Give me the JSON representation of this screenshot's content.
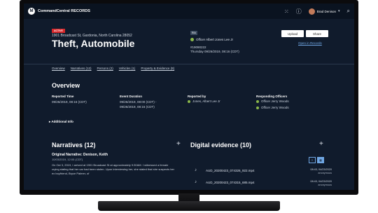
{
  "app": {
    "title": "CommandCentral RECORDS",
    "logo_glyph": "M"
  },
  "user": {
    "name": "Brad Denison"
  },
  "case": {
    "status_badge": "ACTIVE",
    "address": "1901 Broadcast St, Gardonia, North Carolina 28052",
    "title": "Theft, Automobile",
    "type_badge": "RIA",
    "officer": "Officer Albert Jones Lee Jr",
    "case_number": "#19090222",
    "datetime": "Thursday 09/26/2019, 08:16 (CDT)"
  },
  "actions": {
    "upload": "Upload",
    "share": "Share",
    "open_in_records": "Open in Records"
  },
  "subnav": [
    "Overview",
    "Narratives (12)",
    "Persons (2)",
    "Vehicles (1)",
    "Property & Evidence (8)"
  ],
  "overview": {
    "title": "Overview",
    "reported_time_label": "Reported Time",
    "reported_time": "09/26/2019, 08:16 (CDT)",
    "event_duration_label": "Event Duration",
    "event_duration_start": "09/26/2019, 08:00 (CDT) -",
    "event_duration_end": "09/26/2019, 08:16 (CDT)",
    "reported_by_label": "Reported by",
    "reported_by": "Jones, Albert Lee Jr",
    "responding_officers_label": "Responding Officers",
    "responding_officers": [
      "Officer Jerry Woods",
      "Officer Jerry Woods"
    ],
    "additional_info": "Additional Info"
  },
  "narratives": {
    "title": "Narratives (12)",
    "item_title": "Original Narrative: Denison, Keith",
    "item_date": "10/03/2019, 12:00 (CDT)",
    "item_body": "On Oct 3, 2019, I arrived at 1901 Broadcast St at approximately 9:30AM. I witnessed a female crying stating that her car had been stolen. Upon interviewing her, she stated that she suspects her ex boyfriend, Bryce Palmer, of"
  },
  "evidence": {
    "title": "Digital evidence (10)",
    "items": [
      {
        "name": "AUD_20200423_074326_922.mp4",
        "date": "08:43, 04/23/2020",
        "user": "anonymous"
      },
      {
        "name": "AUD_20200423_074315_685.mp4",
        "date": "08:43, 04/23/2020",
        "user": "anonymous"
      }
    ]
  },
  "icons": {
    "grid": "grid-icon",
    "info": "info-icon",
    "search": "search-icon",
    "plus": "plus-icon",
    "audio": "audio-icon",
    "caret": "caret-down-icon"
  },
  "colors": {
    "screen_bg": "#101b2c",
    "topbar_bg": "#0a1320",
    "active_red": "#d8282b",
    "link_blue": "#6fa6e3",
    "officer_green": "#8bb84a"
  }
}
